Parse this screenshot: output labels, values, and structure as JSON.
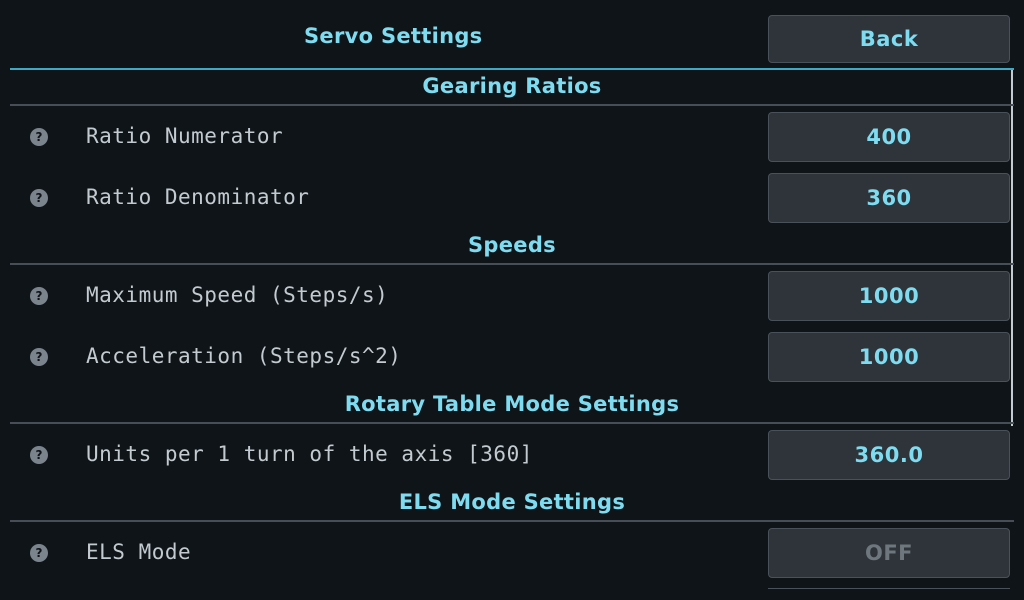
{
  "header": {
    "title": "Servo Settings",
    "back_label": "Back"
  },
  "sections": {
    "gearing": {
      "title": "Gearing Ratios",
      "rows": [
        {
          "label": "Ratio Numerator",
          "value": "400",
          "help_icon": "?"
        },
        {
          "label": "Ratio Denominator",
          "value": "360",
          "help_icon": "?"
        }
      ]
    },
    "speeds": {
      "title": "Speeds",
      "rows": [
        {
          "label": "Maximum Speed (Steps/s)",
          "value": "1000",
          "help_icon": "?"
        },
        {
          "label": "Acceleration (Steps/s^2)",
          "value": "1000",
          "help_icon": "?"
        }
      ]
    },
    "rotary": {
      "title": "Rotary Table Mode Settings",
      "rows": [
        {
          "label": "Units per 1 turn of the axis [360]",
          "value": "360.0",
          "help_icon": "?"
        }
      ]
    },
    "els": {
      "title": "ELS Mode Settings",
      "rows": [
        {
          "label": "ELS Mode",
          "value": "OFF",
          "help_icon": "?",
          "disabled": true
        }
      ]
    }
  },
  "colors": {
    "background": "#0f1419",
    "accent": "#7fdcf0",
    "header_line": "#3fa9c4",
    "button_bg": "#2e343a",
    "label_text": "#c3cbd1",
    "disabled_text": "#6f777e"
  }
}
